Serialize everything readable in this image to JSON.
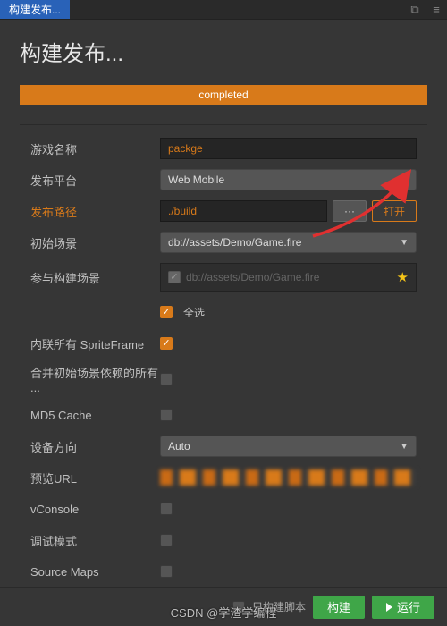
{
  "titlebar": {
    "tab": "构建发布..."
  },
  "page": {
    "title": "构建发布..."
  },
  "progress": {
    "label": "completed"
  },
  "form": {
    "gameName": {
      "label": "游戏名称",
      "value": "packge"
    },
    "platform": {
      "label": "发布平台",
      "value": "Web Mobile"
    },
    "buildPath": {
      "label": "发布路径",
      "value": "./build",
      "browse": "···",
      "open": "打开"
    },
    "startScene": {
      "label": "初始场景",
      "value": "db://assets/Demo/Game.fire"
    },
    "includedScenes": {
      "label": "参与构建场景",
      "item": "db://assets/Demo/Game.fire",
      "selectAll": "全选"
    },
    "inlineSprite": {
      "label": "内联所有 SpriteFrame"
    },
    "mergeDeps": {
      "label": "合并初始场景依赖的所有 ..."
    },
    "md5": {
      "label": "MD5 Cache"
    },
    "orientation": {
      "label": "设备方向",
      "value": "Auto"
    },
    "previewUrl": {
      "label": "预览URL"
    },
    "vconsole": {
      "label": "vConsole"
    },
    "debug": {
      "label": "调试模式"
    },
    "sourceMaps": {
      "label": "Source Maps"
    }
  },
  "footer": {
    "scriptOnly": "只构建脚本",
    "build": "构建",
    "run": "运行"
  },
  "watermark": "CSDN @学渣学编程"
}
